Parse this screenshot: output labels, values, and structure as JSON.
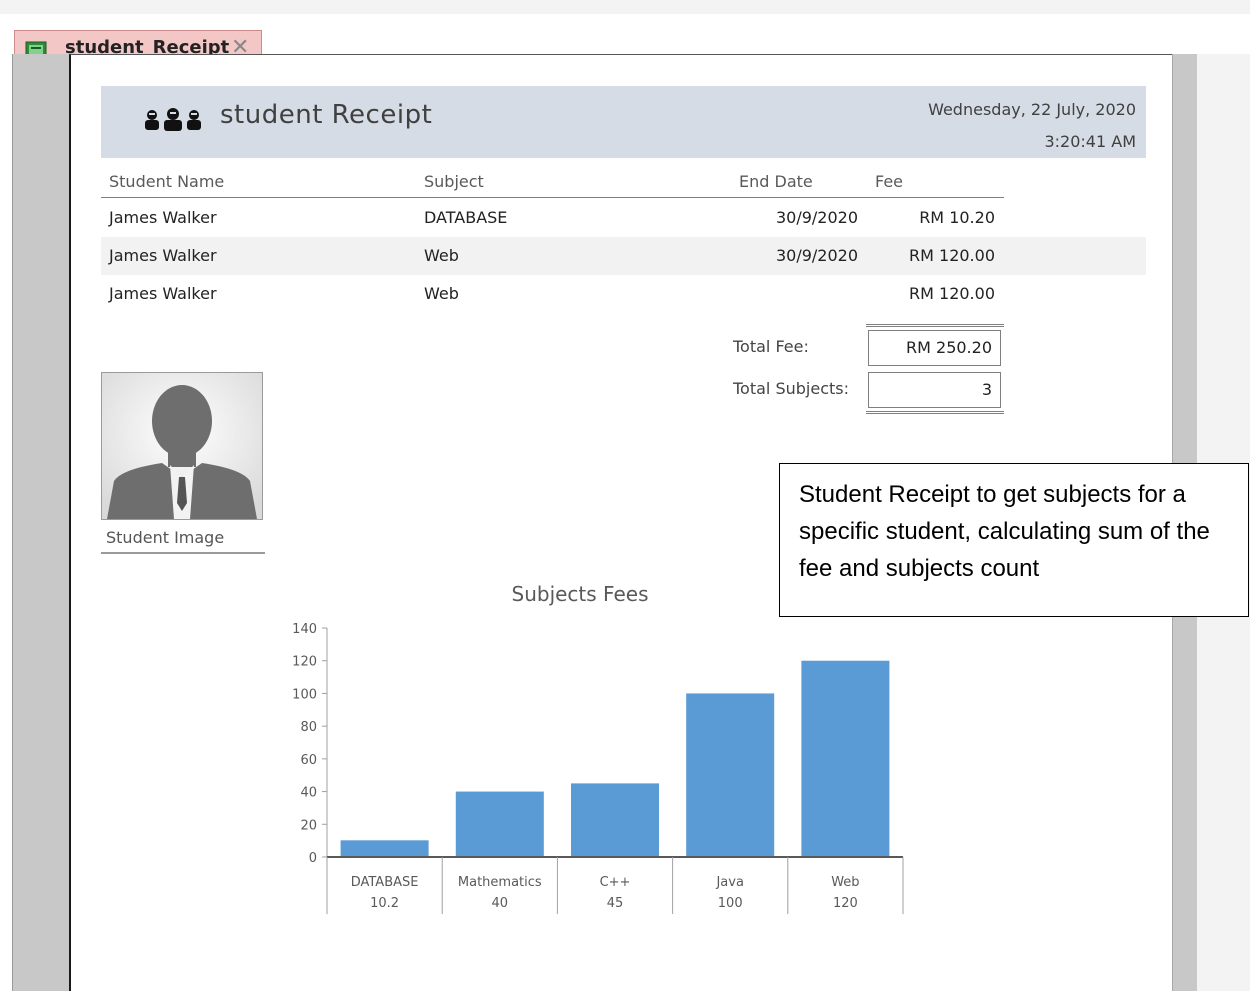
{
  "tab": {
    "label": "student_Receipt",
    "close_glyph": "✕"
  },
  "header": {
    "title": "student Receipt",
    "date": "Wednesday, 22 July, 2020",
    "time": "3:20:41 AM"
  },
  "columns": {
    "student_name": "Student Name",
    "subject": "Subject",
    "end_date": "End Date",
    "fee": "Fee"
  },
  "rows": [
    {
      "student_name": "James Walker",
      "subject": "DATABASE",
      "end_date": "30/9/2020",
      "fee": "RM 10.20"
    },
    {
      "student_name": "James Walker",
      "subject": "Web",
      "end_date": "30/9/2020",
      "fee": "RM 120.00"
    },
    {
      "student_name": "James Walker",
      "subject": "Web",
      "end_date": "",
      "fee": "RM 120.00"
    }
  ],
  "totals": {
    "fee_label": "Total Fee:",
    "fee_value": "RM 250.20",
    "subjects_label": "Total Subjects:",
    "subjects_value": "3"
  },
  "photo": {
    "label": "Student Image"
  },
  "callout": {
    "text": "Student Receipt to get subjects for a specific student, calculating sum of the fee and subjects count"
  },
  "chart_data": {
    "type": "bar",
    "title": "Subjects Fees",
    "categories": [
      "DATABASE",
      "Mathematics",
      "C++",
      "Java",
      "Web"
    ],
    "value_labels": [
      "10.2",
      "40",
      "45",
      "100",
      "120"
    ],
    "values": [
      10.2,
      40,
      45,
      100,
      120
    ],
    "ylim": [
      0,
      140
    ],
    "yticks": [
      0,
      20,
      40,
      60,
      80,
      100,
      120,
      140
    ],
    "bar_color": "#5b9bd5",
    "grid": false
  }
}
